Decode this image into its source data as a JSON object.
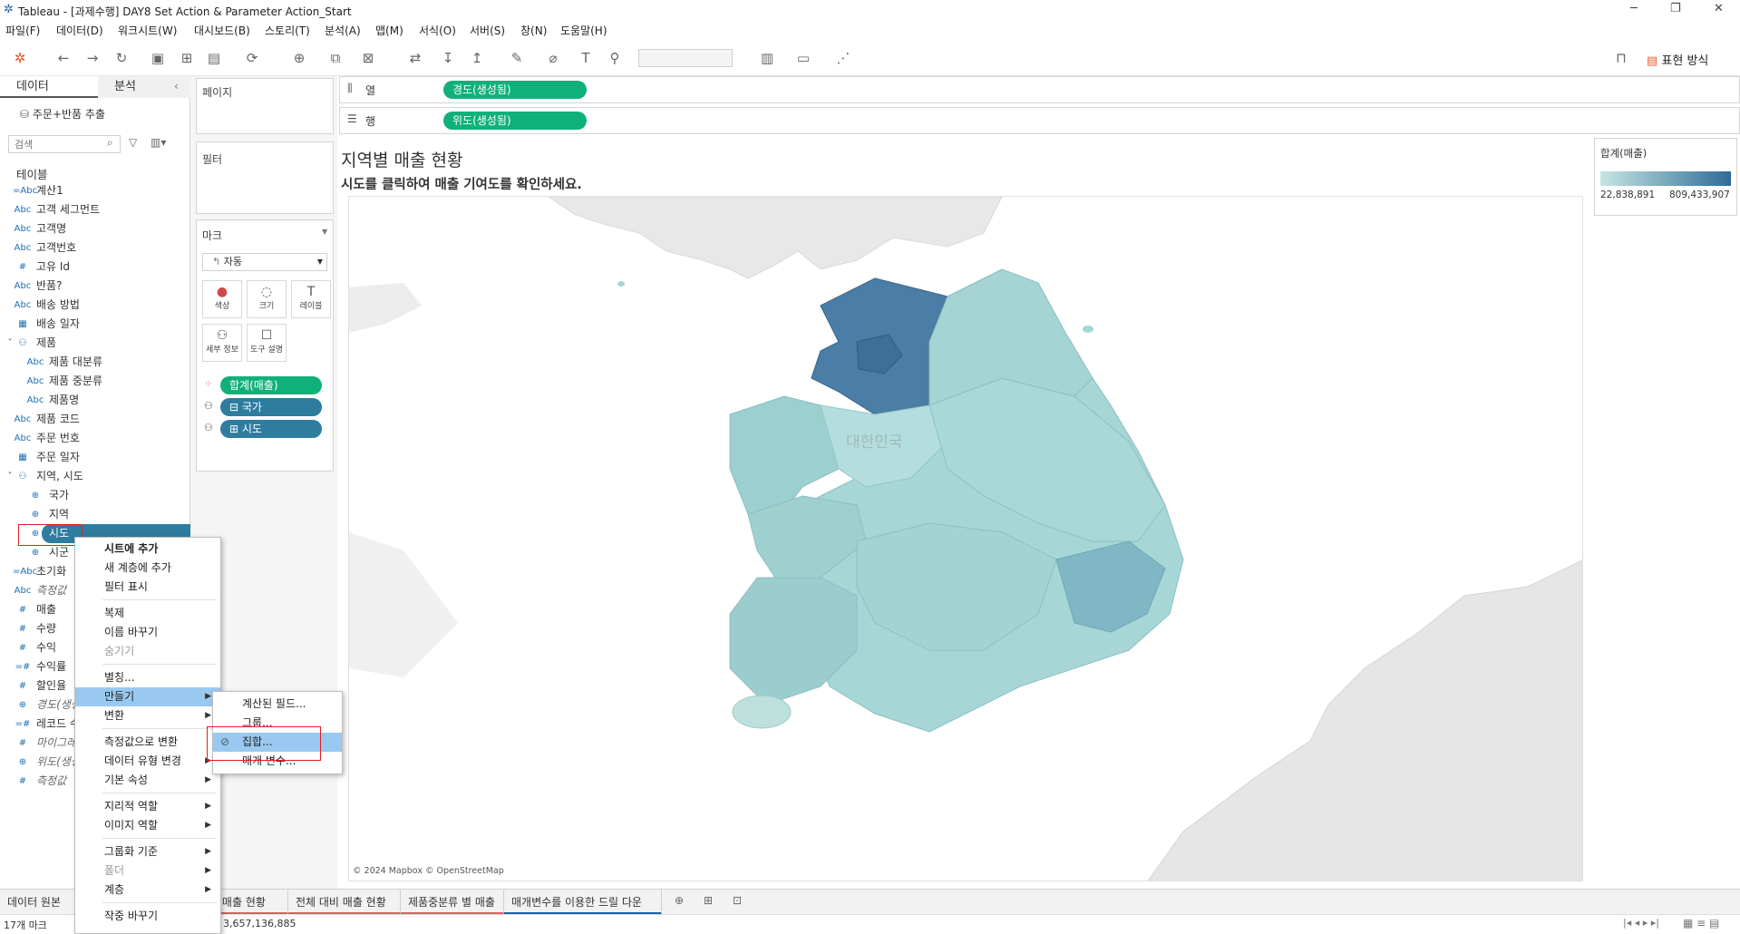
{
  "window": {
    "title": "Tableau - [과제수행] DAY8 Set Action & Parameter Action_Start",
    "min": "─",
    "max": "❐",
    "close": "✕"
  },
  "menu": [
    "파일(F)",
    "데이터(D)",
    "워크시트(W)",
    "대시보드(B)",
    "스토리(T)",
    "분석(A)",
    "맵(M)",
    "서식(O)",
    "서버(S)",
    "창(N)",
    "도움말(H)"
  ],
  "toolbar": {
    "show_me": "표현 방식"
  },
  "data_pane": {
    "tab_data": "데이터",
    "tab_analysis": "분석",
    "source": "주문+반품 추출",
    "search_placeholder": "검색",
    "tables_label": "테이블",
    "fields": [
      {
        "icon": "=Abc",
        "name": "계산1",
        "indent": 0
      },
      {
        "icon": "Abc",
        "name": "고객 세그먼트",
        "indent": 0
      },
      {
        "icon": "Abc",
        "name": "고객명",
        "indent": 0
      },
      {
        "icon": "Abc",
        "name": "고객번호",
        "indent": 0
      },
      {
        "icon": "#",
        "name": "고유 Id",
        "indent": 0
      },
      {
        "icon": "Abc",
        "name": "반품?",
        "indent": 0
      },
      {
        "icon": "Abc",
        "name": "배송 방법",
        "indent": 0
      },
      {
        "icon": "▦",
        "name": "배송 일자",
        "indent": 0
      },
      {
        "icon": "⚇",
        "name": "제품",
        "indent": 0,
        "folder": true
      },
      {
        "icon": "Abc",
        "name": "제품 대분류",
        "indent": 1
      },
      {
        "icon": "Abc",
        "name": "제품 중분류",
        "indent": 1
      },
      {
        "icon": "Abc",
        "name": "제품명",
        "indent": 1
      },
      {
        "icon": "Abc",
        "name": "제품 코드",
        "indent": 0
      },
      {
        "icon": "Abc",
        "name": "주문 번호",
        "indent": 0
      },
      {
        "icon": "▦",
        "name": "주문 일자",
        "indent": 0
      },
      {
        "icon": "⚇",
        "name": "지역, 시도",
        "indent": 0,
        "folder": true
      },
      {
        "icon": "⊕",
        "name": "국가",
        "indent": 1
      },
      {
        "icon": "⊕",
        "name": "지역",
        "indent": 1
      },
      {
        "icon": "⊕",
        "name": "시도",
        "indent": 1,
        "selected": true
      },
      {
        "icon": "⊕",
        "name": "시군",
        "indent": 1
      },
      {
        "icon": "=Abc",
        "name": "초기화",
        "indent": 0
      },
      {
        "icon": "Abc",
        "name": "측정값",
        "indent": 0,
        "italic": true
      },
      {
        "icon": "#",
        "name": "매출",
        "indent": 0
      },
      {
        "icon": "#",
        "name": "수량",
        "indent": 0
      },
      {
        "icon": "#",
        "name": "수익",
        "indent": 0
      },
      {
        "icon": "=#",
        "name": "수익률",
        "indent": 0
      },
      {
        "icon": "#",
        "name": "할인율",
        "indent": 0
      },
      {
        "icon": "⊕",
        "name": "경도(생성됨)",
        "indent": 0,
        "italic": true
      },
      {
        "icon": "=#",
        "name": "레코드 수",
        "indent": 0
      },
      {
        "icon": "#",
        "name": "마이그레이션",
        "indent": 0,
        "italic": true
      },
      {
        "icon": "⊕",
        "name": "위도(생성됨)",
        "indent": 0,
        "italic": true
      },
      {
        "icon": "#",
        "name": "측정값",
        "indent": 0,
        "italic": true
      }
    ]
  },
  "shelves": {
    "pages": "페이지",
    "filters": "필터",
    "marks": "마크",
    "mark_type": "자동",
    "columns_label": "열",
    "rows_label": "행",
    "columns_pill": "경도(생성됨)",
    "rows_pill": "위도(생성됨)"
  },
  "mark_buttons": [
    "색상",
    "크기",
    "레이블",
    "세부 정보",
    "도구 설명"
  ],
  "mark_pills": [
    {
      "icon": "color",
      "label": "합계(매출)",
      "color": "#10b07a"
    },
    {
      "icon": "detail",
      "label": "⊟ 국가",
      "color": "#2e7d9e"
    },
    {
      "icon": "detail",
      "label": "⊞ 시도",
      "color": "#2e7d9e"
    }
  ],
  "viz": {
    "title": "지역별 매출 현황",
    "subtitle": "시도를 클릭하여 매출 기여도를 확인하세요.",
    "country_label": "대한민국",
    "attribution": "© 2024 Mapbox © OpenStreetMap"
  },
  "legend": {
    "title": "합계(매출)",
    "min": "22,838,891",
    "max": "809,433,907",
    "color_low": "#c6e6e3",
    "color_high": "#2f6c97"
  },
  "tabs": [
    "데이터 원본",
    "시도별 매출 현황",
    "전체 대비 매출 현황",
    "제품중분류 별 매출",
    "매개변수를 이용한 드릴 다운"
  ],
  "status": {
    "marks": "17개 마크",
    "sum": "3,657,136,885"
  },
  "context_menu": [
    {
      "label": "시트에 추가",
      "bold": true
    },
    {
      "label": "새 계층에 추가"
    },
    {
      "label": "필터 표시"
    },
    {
      "sep": true
    },
    {
      "label": "복제"
    },
    {
      "label": "이름 바꾸기"
    },
    {
      "label": "숨기기",
      "disabled": true
    },
    {
      "sep": true
    },
    {
      "label": "별칭..."
    },
    {
      "label": "만들기",
      "submenu": true,
      "active": true
    },
    {
      "label": "변환",
      "submenu": true
    },
    {
      "sep": true
    },
    {
      "label": "측정값으로 변환"
    },
    {
      "label": "데이터 유형 변경",
      "submenu": true
    },
    {
      "label": "기본 속성",
      "submenu": true
    },
    {
      "sep": true
    },
    {
      "label": "지리적 역할",
      "submenu": true
    },
    {
      "label": "이미지 역할",
      "submenu": true
    },
    {
      "sep": true
    },
    {
      "label": "그룹화 기준",
      "submenu": true
    },
    {
      "label": "폴더",
      "submenu": true,
      "disabled": true
    },
    {
      "label": "계층",
      "submenu": true
    },
    {
      "sep": true
    },
    {
      "label": "작중 바꾸기"
    }
  ],
  "submenu": [
    {
      "label": "계산된 필드..."
    },
    {
      "label": "그룹..."
    },
    {
      "label": "집합...",
      "active": true
    },
    {
      "label": "매개 변수..."
    }
  ]
}
